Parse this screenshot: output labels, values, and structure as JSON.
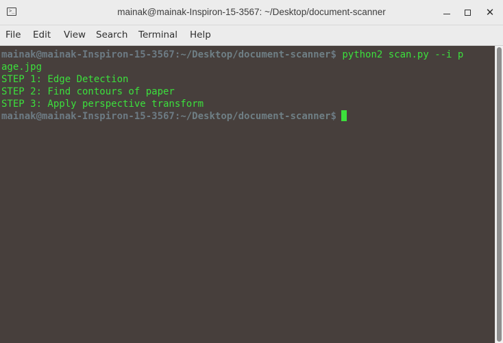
{
  "window": {
    "title": "mainak@mainak-Inspiron-15-3567: ~/Desktop/document-scanner",
    "controls": {
      "minimize_icon": "minimize-icon",
      "maximize_icon": "maximize-icon",
      "close_label": "✕"
    }
  },
  "menubar": {
    "items": [
      "File",
      "Edit",
      "View",
      "Search",
      "Terminal",
      "Help"
    ]
  },
  "terminal": {
    "prompt": {
      "userhost": "mainak@mainak-Inspiron-15-3567",
      "colon": ":",
      "path": "~/Desktop/document-scanner",
      "dollar": "$"
    },
    "command_part1": " python2 scan.py --i p",
    "command_part2": "age.jpg",
    "output": [
      "STEP 1: Edge Detection",
      "STEP 2: Find contours of paper",
      "STEP 3: Apply perspective transform"
    ]
  },
  "colors": {
    "background": "#473f3c",
    "text_green": "#3ce03c",
    "prompt_gray": "#6d7b84"
  }
}
